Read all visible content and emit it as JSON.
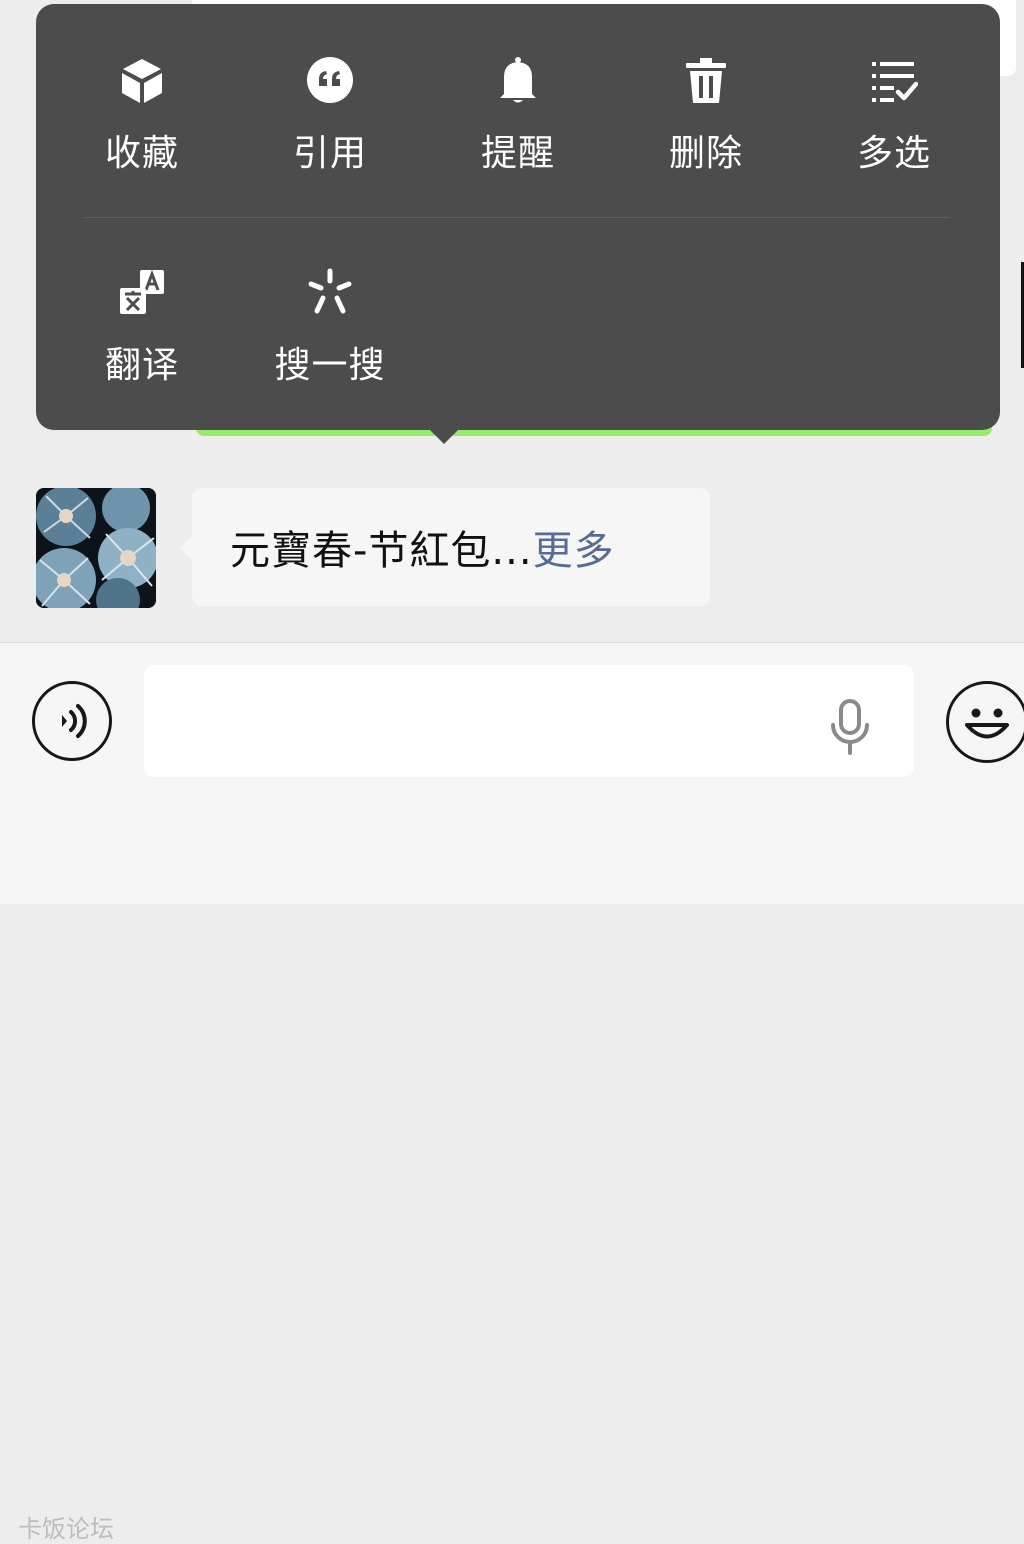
{
  "context_menu": {
    "items": [
      {
        "label": "收藏",
        "icon": "cube-icon"
      },
      {
        "label": "引用",
        "icon": "quote-icon"
      },
      {
        "label": "提醒",
        "icon": "bell-icon"
      },
      {
        "label": "删除",
        "icon": "trash-icon"
      },
      {
        "label": "多选",
        "icon": "multi-select-icon"
      },
      {
        "label": "翻译",
        "icon": "translate-icon"
      },
      {
        "label": "搜一搜",
        "icon": "search-sparkle-icon"
      }
    ]
  },
  "message": {
    "text": "元寶春-节紅包...",
    "more": "更多"
  },
  "input_bar": {
    "voice_icon": "voice-mode-icon",
    "mic_icon": "microphone-icon",
    "emoji_icon": "emoji-icon"
  },
  "watermark": "卡饭论坛",
  "colors": {
    "popup_bg": "#4c4c4c",
    "link": "#576b95",
    "outgoing_bubble": "#95ec69",
    "chat_bg": "#ededed"
  }
}
